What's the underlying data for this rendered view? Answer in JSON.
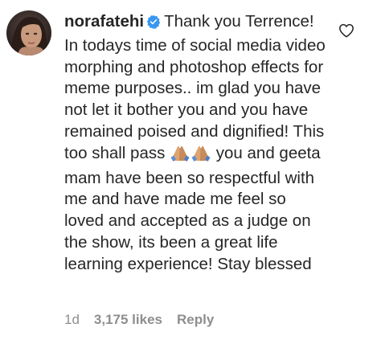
{
  "comment": {
    "username": "norafatehi",
    "verified": true,
    "text_part1": "Thank you Terrence! In todays time of social media video morphing and photoshop effects for meme purposes.. im glad you have not let it bother you and you have remained poised and dignified! This too shall pass",
    "emoji": "folded-hands x2",
    "text_part2": "you and geeta mam have been so respectful with me and have made me feel so loved and accepted as a judge on the show, its been a great life learning experience! Stay blessed"
  },
  "meta": {
    "time": "1d",
    "likes": "3,175 likes",
    "reply_label": "Reply"
  },
  "icons": {
    "verified": "verified-badge-icon",
    "like": "heart-outline-icon",
    "emoji": "folded-hands-icon"
  },
  "colors": {
    "text": "#262626",
    "secondary": "#8e8e8e",
    "verified_blue": "#3897f0"
  }
}
